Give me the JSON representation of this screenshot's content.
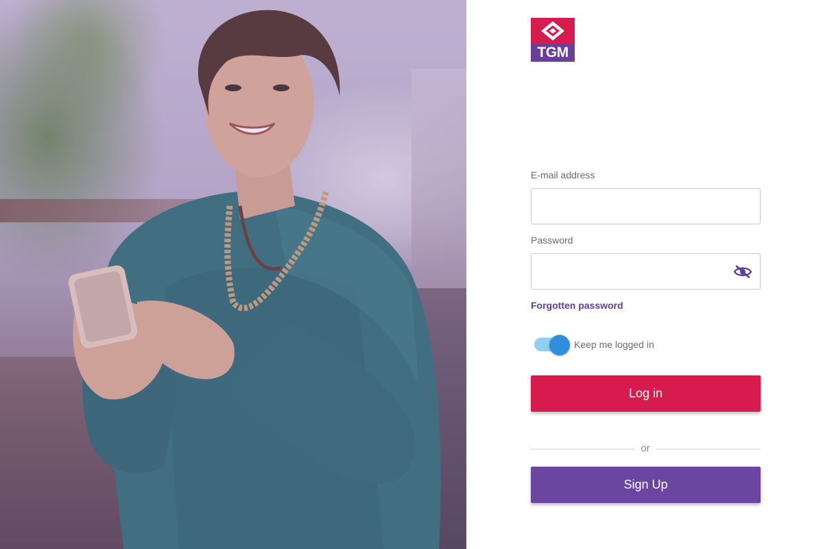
{
  "logo": {
    "text": "TGM",
    "colors": {
      "top": "#d81b4f",
      "bottom": "#6a3e9a"
    }
  },
  "hero": {
    "icon": "woman-with-phone-photo"
  },
  "form": {
    "email": {
      "label": "E-mail address",
      "value": "",
      "placeholder": ""
    },
    "password": {
      "label": "Password",
      "value": "",
      "placeholder": "",
      "toggle_icon": "eye-slash-icon"
    },
    "forgot_link": "Forgotten password",
    "keep_logged_in": {
      "label": "Keep me logged in",
      "checked": true
    },
    "login_button": "Log in",
    "divider": "or",
    "signup_button": "Sign Up"
  },
  "colors": {
    "primary": "#d81b4f",
    "secondary": "#6b46a1",
    "link": "#5b3f96",
    "toggle_knob": "#2f8fdb",
    "toggle_track": "#8fd0f3"
  }
}
